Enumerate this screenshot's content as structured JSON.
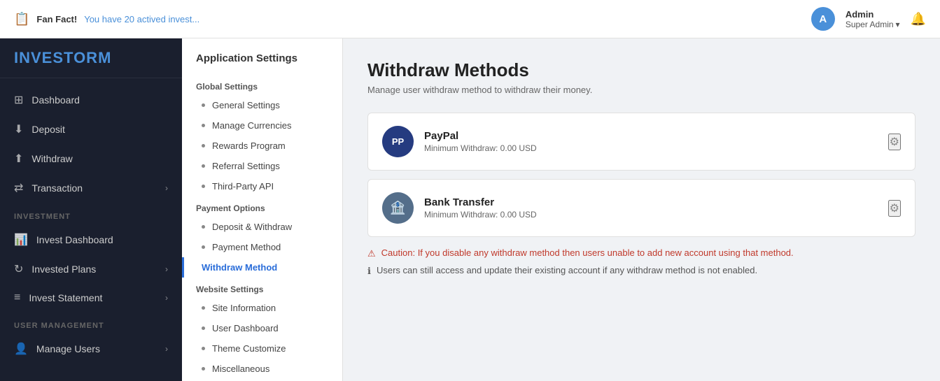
{
  "topbar": {
    "fan_fact_label": "Fan Fact!",
    "fan_fact_text": "You have 20 actived invest...",
    "admin_name": "Admin",
    "admin_role": "Super Admin",
    "bell_icon": "🔔"
  },
  "sidebar": {
    "logo_invest": "INVEST",
    "logo_orm": "ORM",
    "items": [
      {
        "label": "Dashboard",
        "icon": "⊞",
        "section": null
      },
      {
        "label": "Deposit",
        "icon": "↓",
        "section": null
      },
      {
        "label": "Withdraw",
        "icon": "↑",
        "section": null
      },
      {
        "label": "Transaction",
        "icon": "⇄",
        "section": null,
        "arrow": "›"
      },
      {
        "label": "INVESTMENT",
        "section_header": true
      },
      {
        "label": "Invest Dashboard",
        "icon": "📊",
        "section": "investment"
      },
      {
        "label": "Invested Plans",
        "icon": "↻",
        "section": "investment",
        "arrow": "›"
      },
      {
        "label": "Invest Statement",
        "icon": "≡",
        "section": "investment",
        "arrow": "›"
      },
      {
        "label": "USER MANAGEMENT",
        "section_header": true
      },
      {
        "label": "Manage Users",
        "icon": "👤",
        "section": "user",
        "arrow": "›"
      }
    ]
  },
  "middle_panel": {
    "title": "Application Settings",
    "sections": [
      {
        "label": "Global Settings",
        "items": [
          {
            "label": "General Settings",
            "active": false
          },
          {
            "label": "Manage Currencies",
            "active": false
          },
          {
            "label": "Rewards Program",
            "active": false
          },
          {
            "label": "Referral Settings",
            "active": false
          },
          {
            "label": "Third-Party API",
            "active": false
          }
        ]
      },
      {
        "label": "Payment Options",
        "items": [
          {
            "label": "Deposit & Withdraw",
            "active": false
          },
          {
            "label": "Payment Method",
            "active": false
          },
          {
            "label": "Withdraw Method",
            "active": true
          }
        ]
      },
      {
        "label": "Website Settings",
        "items": [
          {
            "label": "Site Information",
            "active": false
          },
          {
            "label": "User Dashboard",
            "active": false
          },
          {
            "label": "Theme Customize",
            "active": false
          },
          {
            "label": "Miscellaneous",
            "active": false
          }
        ]
      }
    ]
  },
  "main": {
    "title": "Withdraw Methods",
    "subtitle": "Manage user withdraw method to withdraw their money.",
    "methods": [
      {
        "id": "paypal",
        "name": "PayPal",
        "logo_text": "PP",
        "logo_class": "paypal",
        "min_withdraw": "Minimum Withdraw: 0.00 USD"
      },
      {
        "id": "bank",
        "name": "Bank Transfer",
        "logo_text": "🏦",
        "logo_class": "bank",
        "min_withdraw": "Minimum Withdraw: 0.00 USD"
      }
    ],
    "notices": [
      {
        "type": "warn",
        "icon": "⚠",
        "text": "Caution: If you disable any withdraw method then users unable to add new account using that method."
      },
      {
        "type": "info",
        "icon": "ℹ",
        "text": "Users can still access and update their existing account if any withdraw method is not enabled."
      }
    ]
  }
}
